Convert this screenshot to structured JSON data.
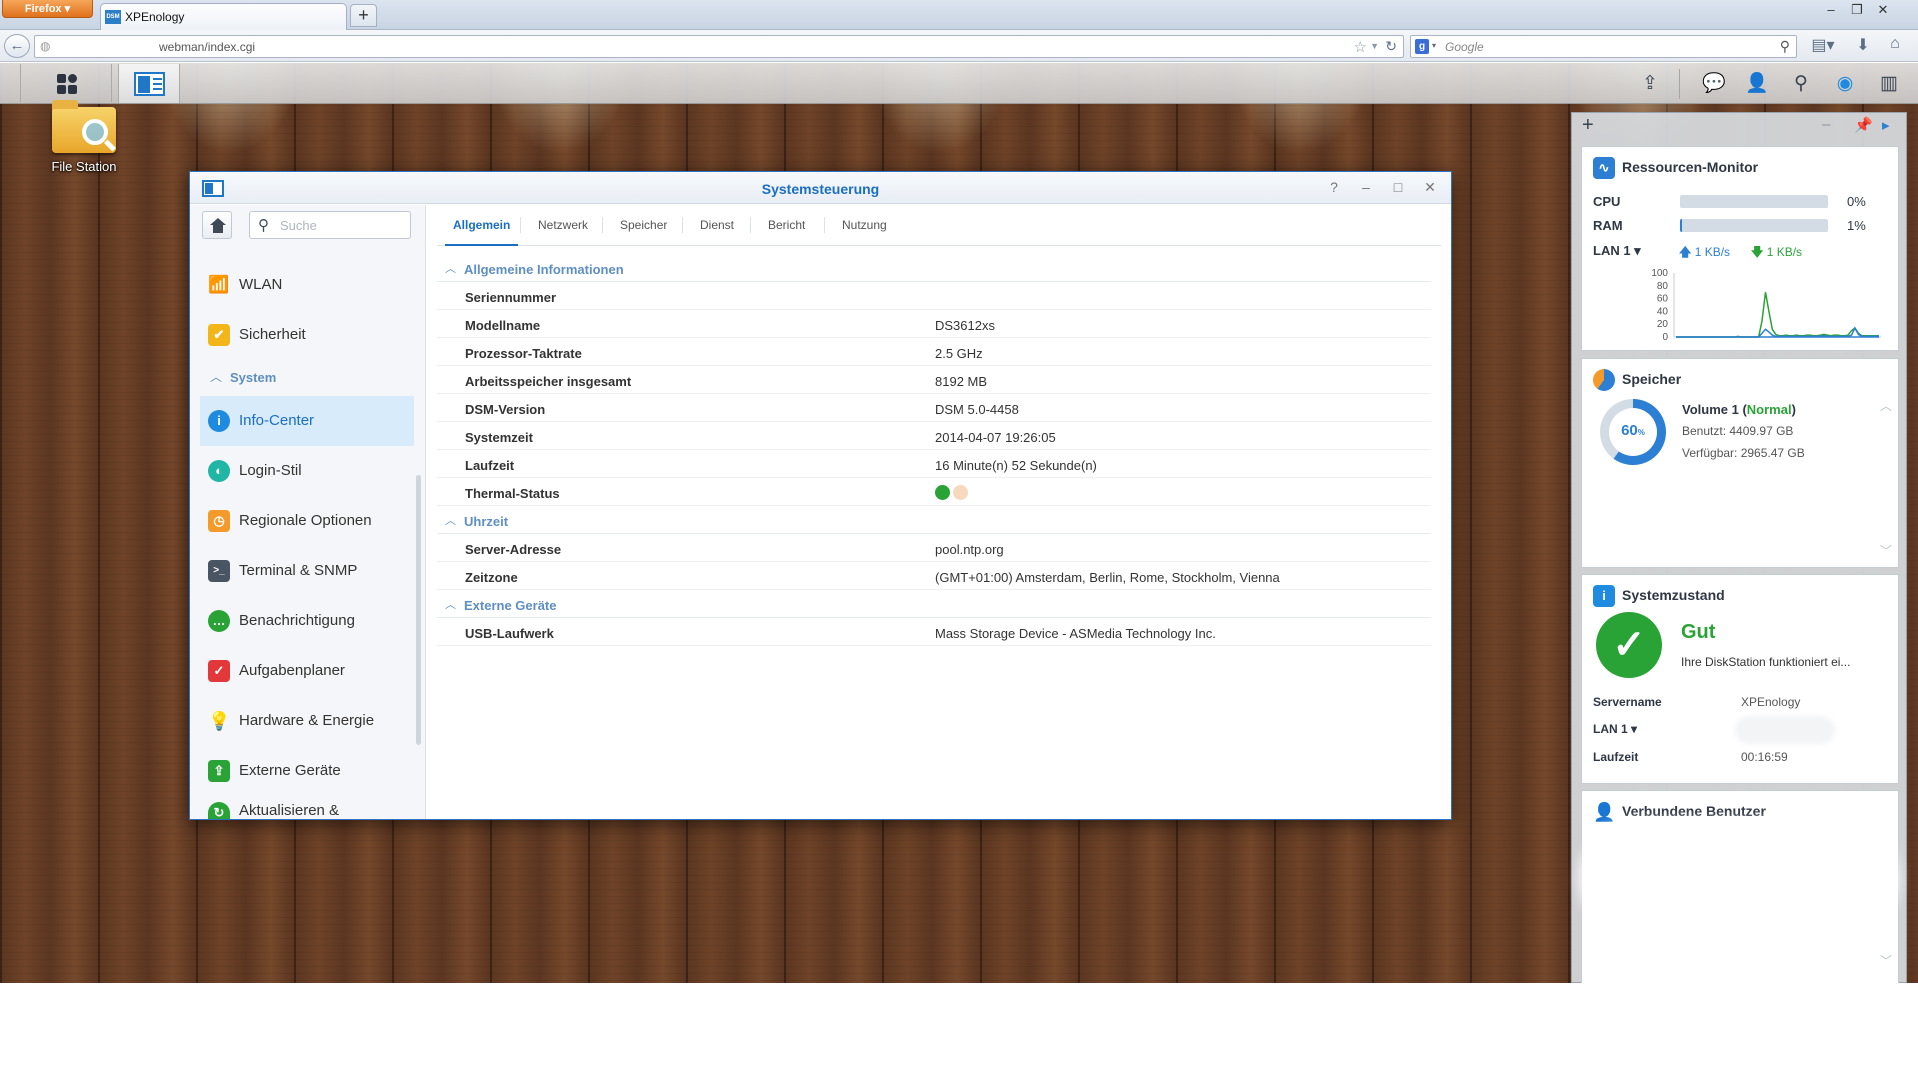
{
  "browser": {
    "menu_label": "Firefox",
    "tab_title": "XPEnology",
    "tab_favicon_text": "DSM",
    "new_tab_label": "+",
    "url": "webman/index.cgi",
    "search_placeholder": "Google"
  },
  "taskbar": {
    "icons": [
      "main-menu-icon",
      "control-panel-icon",
      "upload-icon",
      "chat-icon",
      "user-icon",
      "search-icon",
      "dsm-icon",
      "widgets-icon"
    ]
  },
  "desktop": {
    "shortcut_label": "File Station"
  },
  "control_panel": {
    "title": "Systemsteuerung",
    "search_placeholder": "Suche",
    "nav": {
      "wlan": "WLAN",
      "sicherheit": "Sicherheit",
      "system_section": "System",
      "info_center": "Info-Center",
      "login_stil": "Login-Stil",
      "regionale": "Regionale Optionen",
      "terminal": "Terminal & SNMP",
      "benachrichtigung": "Benachrichtigung",
      "aufgabenplaner": "Aufgabenplaner",
      "hardware": "Hardware & Energie",
      "externe": "Externe Geräte",
      "aktualisieren": "Aktualisieren &"
    },
    "tabs": [
      "Allgemein",
      "Netzwerk",
      "Speicher",
      "Dienst",
      "Bericht",
      "Nutzung"
    ],
    "sections": {
      "general": "Allgemeine Informationen",
      "time": "Uhrzeit",
      "external": "Externe Geräte"
    },
    "general": [
      {
        "key": "Seriennummer",
        "value": ""
      },
      {
        "key": "Modellname",
        "value": "DS3612xs"
      },
      {
        "key": "Prozessor-Taktrate",
        "value": "2.5 GHz"
      },
      {
        "key": "Arbeitsspeicher insgesamt",
        "value": "8192 MB"
      },
      {
        "key": "DSM-Version",
        "value": "DSM 5.0-4458"
      },
      {
        "key": "Systemzeit",
        "value": "2014-04-07 19:26:05"
      },
      {
        "key": "Laufzeit",
        "value": "16 Minute(n) 52 Sekunde(n)"
      },
      {
        "key": "Thermal-Status",
        "value": ""
      }
    ],
    "thermal_colors": [
      "#2aa336",
      "#f7d9bd"
    ],
    "time": [
      {
        "key": "Server-Adresse",
        "value": "pool.ntp.org"
      },
      {
        "key": "Zeitzone",
        "value": "(GMT+01:00) Amsterdam, Berlin, Rome, Stockholm, Vienna"
      }
    ],
    "external": [
      {
        "key": "USB-Laufwerk",
        "value": "Mass Storage Device - ASMedia Technology Inc."
      }
    ]
  },
  "widgets": {
    "resource_monitor": {
      "title": "Ressourcen-Monitor",
      "cpu_label": "CPU",
      "cpu_value": "0%",
      "cpu_fraction": 0.0,
      "ram_label": "RAM",
      "ram_value": "1%",
      "ram_fraction": 0.01,
      "lan_label": "LAN 1",
      "upload": "1 KB/s",
      "download": "1 KB/s"
    },
    "storage": {
      "title": "Speicher",
      "percent_label": "60",
      "percent_unit": "%",
      "used_fraction": 0.6,
      "volume": "Volume 1 (",
      "status": "Normal",
      "volume_close": ")",
      "used": "Benutzt: 4409.97 GB",
      "available": "Verfügbar: 2965.47 GB"
    },
    "health": {
      "title": "Systemzustand",
      "status": "Gut",
      "message": "Ihre DiskStation funktioniert ei...",
      "server_label": "Servername",
      "server_value": "XPEnology",
      "lan_label": "LAN 1",
      "uptime_label": "Laufzeit",
      "uptime_value": "00:16:59"
    },
    "users": {
      "title": "Verbundene Benutzer"
    }
  },
  "chart_data": {
    "type": "line",
    "yticks": [
      "100",
      "80",
      "60",
      "40",
      "20",
      "0"
    ],
    "ylim": [
      0,
      100
    ],
    "series": [
      {
        "values": [
          0,
          0,
          0,
          0,
          0,
          0,
          0,
          0,
          0,
          0,
          0,
          0,
          0,
          0,
          0,
          0,
          0,
          0,
          1,
          0,
          0,
          0,
          0,
          0,
          0,
          0,
          0,
          0,
          0,
          0,
          0,
          0,
          0,
          0,
          0,
          0,
          0,
          0,
          0,
          0,
          0,
          0,
          0,
          0,
          0,
          0,
          0,
          0,
          0,
          0,
          0,
          0,
          0,
          0,
          0,
          0,
          0,
          0,
          0,
          0
        ]
      },
      {
        "values": [
          0,
          0,
          0,
          0,
          0,
          0,
          0,
          0,
          0,
          0,
          0,
          0,
          0,
          0,
          0,
          0,
          0,
          0,
          0,
          0,
          0,
          0,
          0,
          0,
          0,
          25,
          70,
          40,
          12,
          4,
          2,
          2,
          3,
          2,
          2,
          3,
          2,
          2,
          3,
          3,
          2,
          2,
          3,
          4,
          3,
          2,
          3,
          3,
          2,
          2,
          3,
          10,
          14,
          6,
          2,
          2,
          2,
          2,
          2,
          2
        ]
      },
      {
        "values": [
          0,
          0,
          0,
          0,
          0,
          0,
          0,
          0,
          0,
          0,
          0,
          0,
          0,
          0,
          0,
          0,
          0,
          0,
          0,
          0,
          0,
          0,
          0,
          0,
          0,
          6,
          12,
          8,
          3,
          1,
          1,
          1,
          1,
          1,
          1,
          1,
          1,
          1,
          1,
          1,
          1,
          1,
          1,
          2,
          1,
          1,
          1,
          1,
          1,
          1,
          1,
          3,
          14,
          4,
          1,
          1,
          1,
          1,
          1,
          1
        ]
      }
    ],
    "colors": [
      "#2d7fd3",
      "#2aa336",
      "#2d7fd3"
    ]
  }
}
